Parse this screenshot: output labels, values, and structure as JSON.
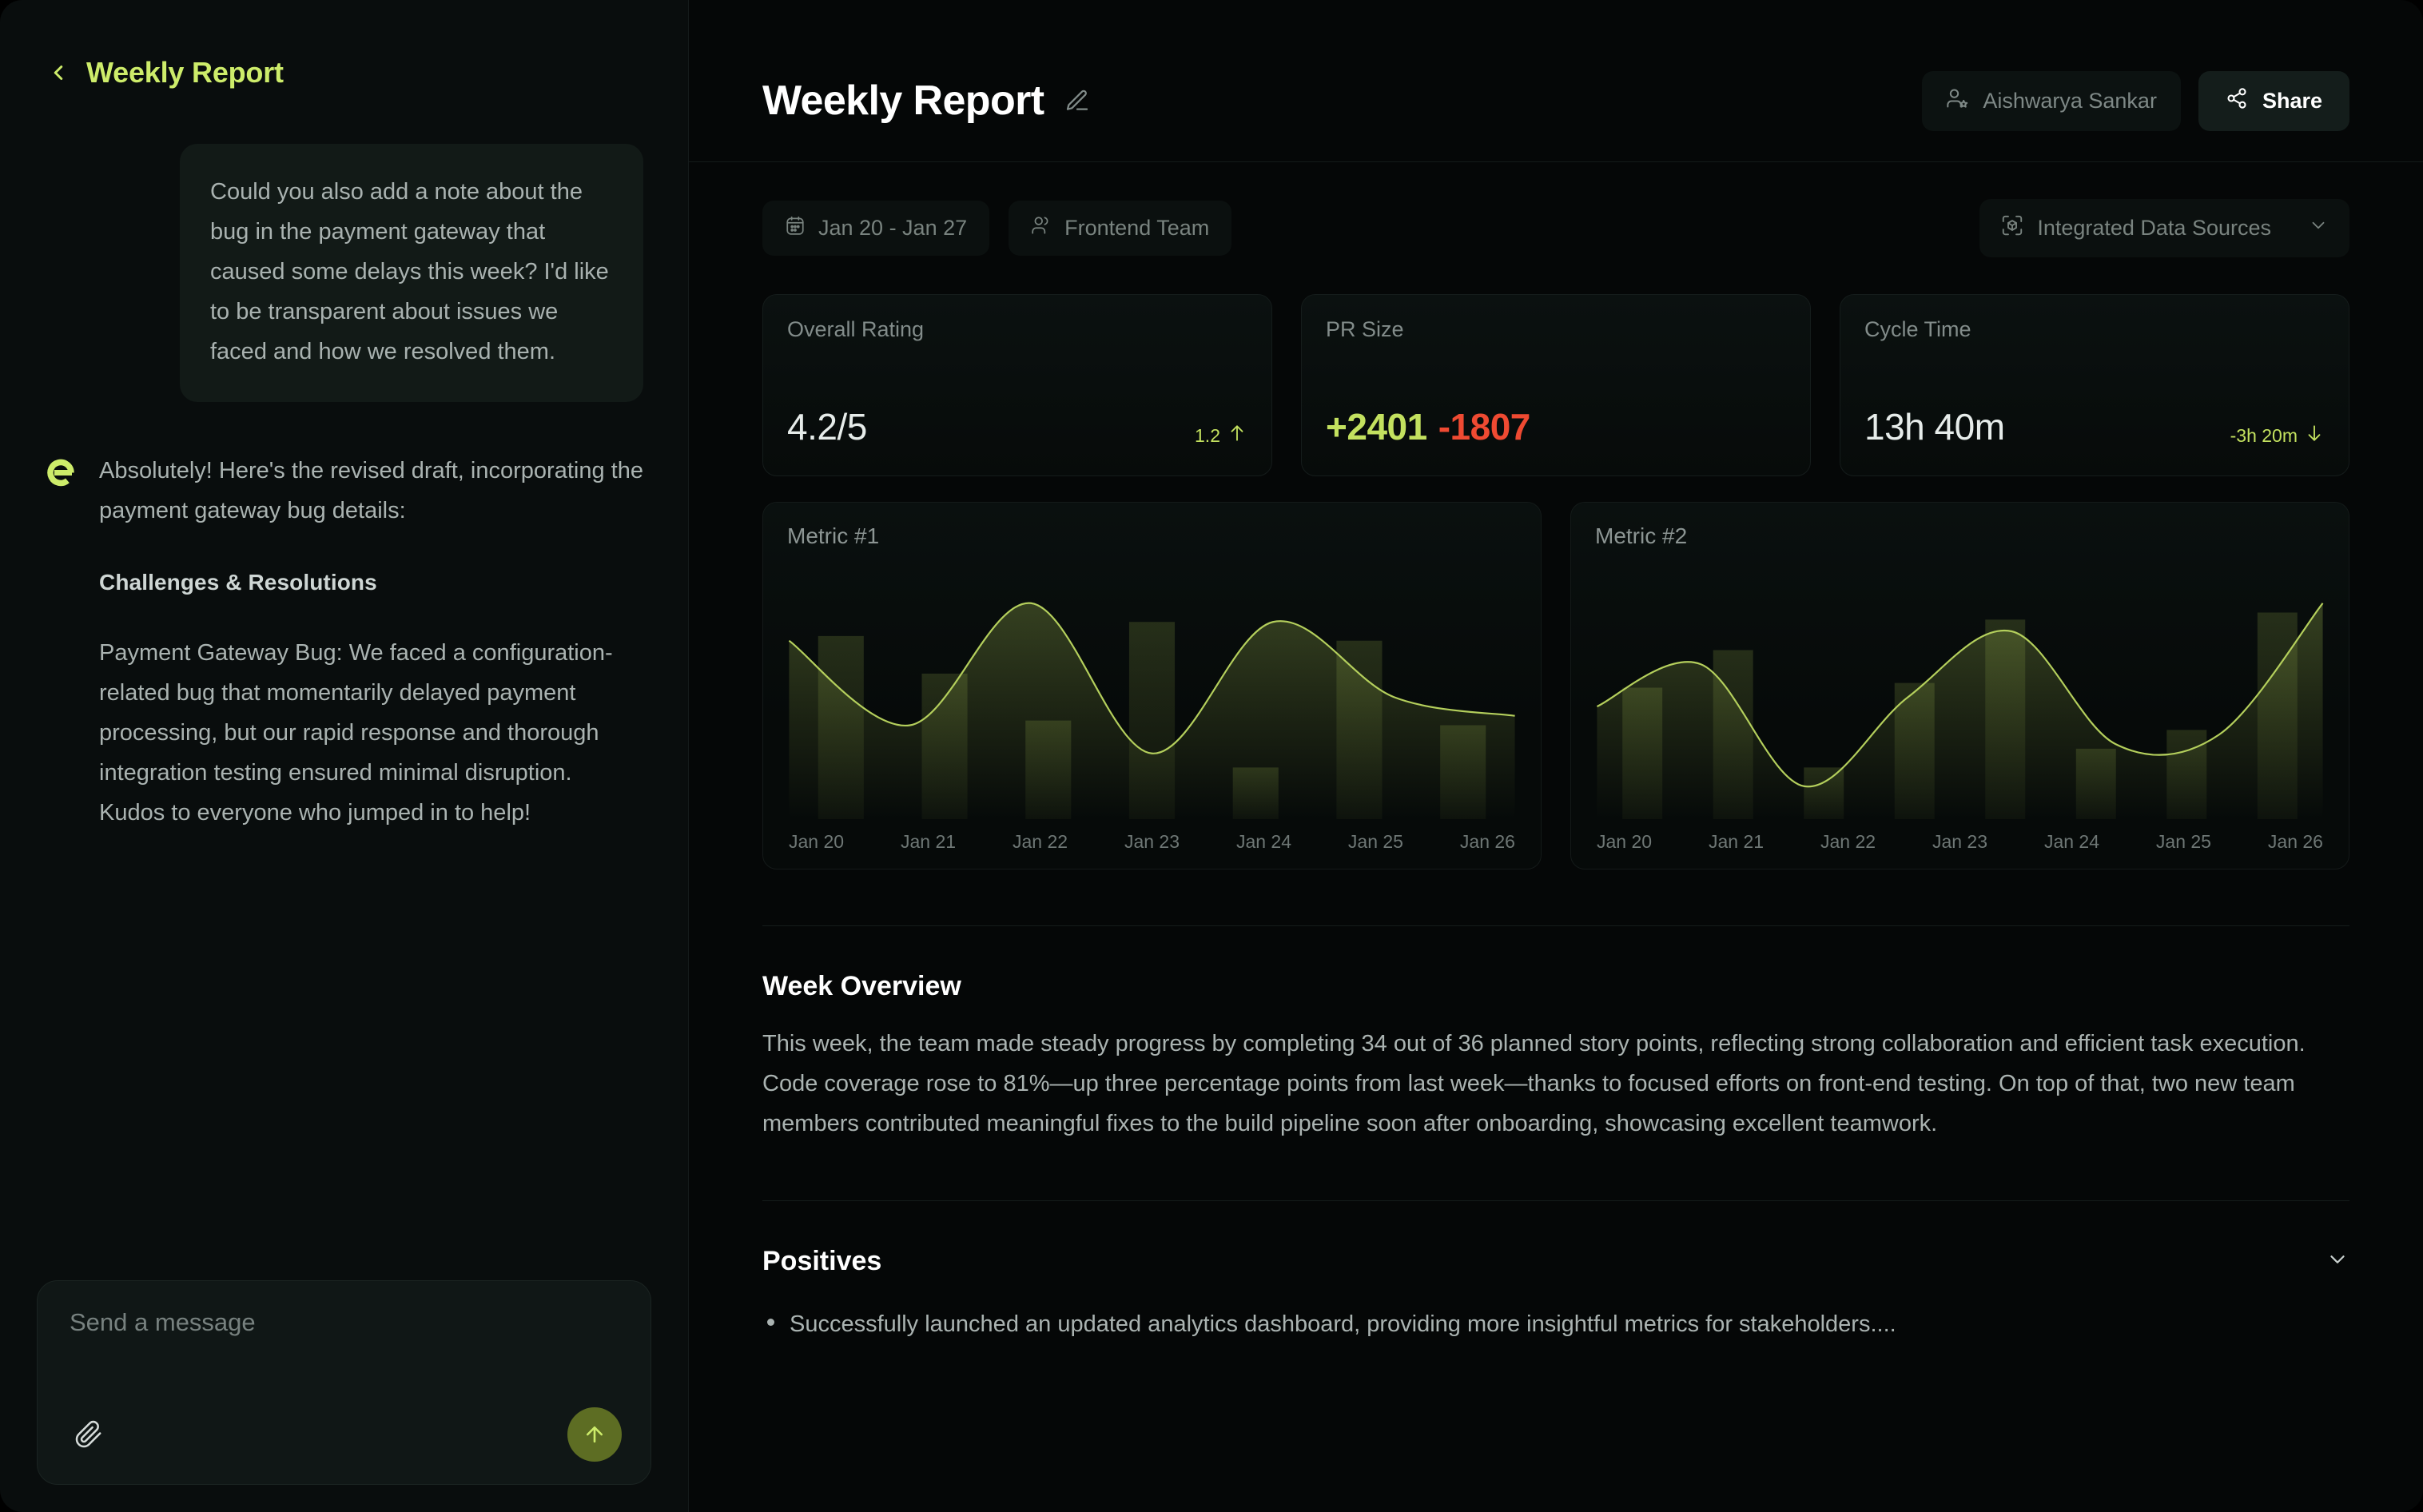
{
  "sidebar": {
    "back_icon": "chevron-left-icon",
    "title": "Weekly Report",
    "user_message": "Could you also add a note about the bug in the payment gateway that caused some delays this week? I'd like to be transparent about issues we faced and how we resolved them.",
    "ai_avatar_icon": "assistant-e-logo",
    "ai_intro": "Absolutely! Here's the revised draft, incorporating the payment gateway bug details:",
    "ai_heading": "Challenges & Resolutions",
    "ai_paragraph": "Payment Gateway Bug: We faced a configuration-related bug that momentarily delayed payment processing, but our rapid response and thorough integration testing ensured minimal disruption. Kudos to everyone who jumped in to help!",
    "composer": {
      "placeholder": "Send a message",
      "value": "",
      "attach_icon": "paperclip-icon",
      "send_icon": "arrow-up-icon"
    }
  },
  "header": {
    "title": "Weekly Report",
    "edit_icon": "pencil-edit-icon",
    "owner": "Aishwarya Sankar",
    "owner_icon": "user-star-icon",
    "share_label": "Share",
    "share_icon": "share-nodes-icon"
  },
  "filters": {
    "date_range": "Jan 20 - Jan 27",
    "date_icon": "calendar-icon",
    "team": "Frontend Team",
    "team_icon": "users-icon",
    "data_sources": "Integrated Data Sources",
    "data_sources_icon": "cube-scan-icon",
    "data_sources_caret": "chevron-down-icon"
  },
  "stats": [
    {
      "label": "Overall Rating",
      "value": "4.2/5",
      "delta": "1.2",
      "direction": "up",
      "color": "#c3e15f"
    },
    {
      "label": "PR Size",
      "value_pos": "+2401",
      "value_neg": "-1807",
      "pos_color": "#c3e15f",
      "neg_color": "#ef4a32"
    },
    {
      "label": "Cycle Time",
      "value": "13h 40m",
      "delta": "-3h 20m",
      "direction": "down",
      "color": "#c3e15f"
    }
  ],
  "overview": {
    "title": "Week Overview",
    "body": "This week, the team made steady progress by completing 34 out of 36 planned story points, reflecting strong collaboration and efficient task execution. Code coverage rose to 81%—up three percentage points from last week—thanks to focused efforts on front-end testing. On top of that, two new team members contributed meaningful fixes to the build pipeline soon after onboarding, showcasing excellent teamwork."
  },
  "positives": {
    "title": "Positives",
    "caret_icon": "chevron-down-icon",
    "items": [
      "Successfully launched an updated analytics dashboard, providing more insightful metrics for stakeholders...."
    ]
  },
  "chart_data": [
    {
      "type": "bar",
      "title": "Metric #1",
      "categories": [
        "Jan 20",
        "Jan 21",
        "Jan 22",
        "Jan 23",
        "Jan 24",
        "Jan 25",
        "Jan 26"
      ],
      "values": [
        78,
        62,
        42,
        84,
        22,
        76,
        40
      ],
      "series": [
        {
          "name": "trend",
          "type": "line",
          "values": [
            76,
            40,
            92,
            28,
            84,
            52,
            44
          ]
        }
      ],
      "xlabel": "",
      "ylabel": "",
      "ylim": [
        0,
        100
      ],
      "grid": false,
      "legend": false
    },
    {
      "type": "bar",
      "title": "Metric #2",
      "categories": [
        "Jan 20",
        "Jan 21",
        "Jan 22",
        "Jan 23",
        "Jan 24",
        "Jan 25",
        "Jan 26"
      ],
      "values": [
        56,
        72,
        22,
        58,
        85,
        30,
        38,
        88
      ],
      "series": [
        {
          "name": "trend",
          "type": "line",
          "values": [
            48,
            66,
            14,
            52,
            80,
            32,
            36,
            92
          ]
        }
      ],
      "xlabel": "",
      "ylabel": "",
      "ylim": [
        0,
        100
      ],
      "grid": false,
      "legend": false
    }
  ]
}
